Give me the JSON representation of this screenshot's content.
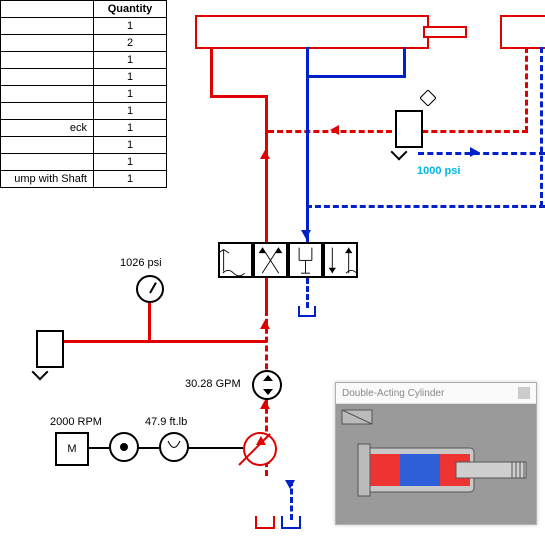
{
  "table": {
    "header_qty": "Quantity",
    "rows": [
      {
        "name": "",
        "qty": "1"
      },
      {
        "name": "",
        "qty": "2"
      },
      {
        "name": "",
        "qty": "1"
      },
      {
        "name": "",
        "qty": "1"
      },
      {
        "name": "",
        "qty": "1"
      },
      {
        "name": "",
        "qty": "1"
      },
      {
        "name": "eck",
        "qty": "1"
      },
      {
        "name": "",
        "qty": "1"
      },
      {
        "name": "",
        "qty": "1"
      },
      {
        "name": "ump with Shaft",
        "qty": "1"
      }
    ]
  },
  "readouts": {
    "pressure_gauge": "1026 psi",
    "pressure_relief": "1000 psi",
    "flow": "30.28 GPM",
    "speed": "2000 RPM",
    "torque": "47.9 ft.lb"
  },
  "inset": {
    "title": "Double-Acting Cylinder"
  },
  "colors": {
    "pressure": "#e00000",
    "return": "#0020c8",
    "reading": "#00b8e6"
  }
}
